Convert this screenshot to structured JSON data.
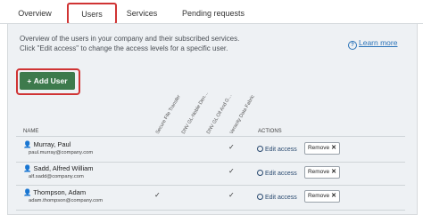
{
  "tabs": [
    "Overview",
    "Users",
    "Services",
    "Pending requests"
  ],
  "overview_text": [
    "Overview of the users in your company and their subscribed services.",
    "Click \"Edit access\" to change the access levels for a specific user."
  ],
  "learn_more": "Learn more",
  "add_user": "Add User",
  "columns": {
    "name": "NAME",
    "actions": "ACTIONS",
    "services": [
      "Secure File Transfer",
      "DNV GL-Noble Den…",
      "DNV GL Oil And G…",
      "Veracity Data Fabric"
    ]
  },
  "users": [
    {
      "name": "Murray, Paul",
      "email": "paul.murray@company.com",
      "checks": [
        false,
        false,
        true,
        false
      ],
      "edit": "Edit access",
      "remove": "Remove"
    },
    {
      "name": "Sadd, Alfred William",
      "email": "alf.sadd@company.com",
      "checks": [
        false,
        false,
        true,
        false
      ],
      "edit": "Edit access",
      "remove": "Remove"
    },
    {
      "name": "Thompson, Adam",
      "email": "adam.thompson@company.com",
      "checks": [
        true,
        false,
        true,
        false
      ],
      "edit": "Edit access",
      "remove": "Remove"
    }
  ],
  "icons": {
    "user": "person-icon",
    "edit": "gear-icon",
    "remove": "close-icon",
    "info": "info-icon",
    "add": "plus-icon"
  }
}
